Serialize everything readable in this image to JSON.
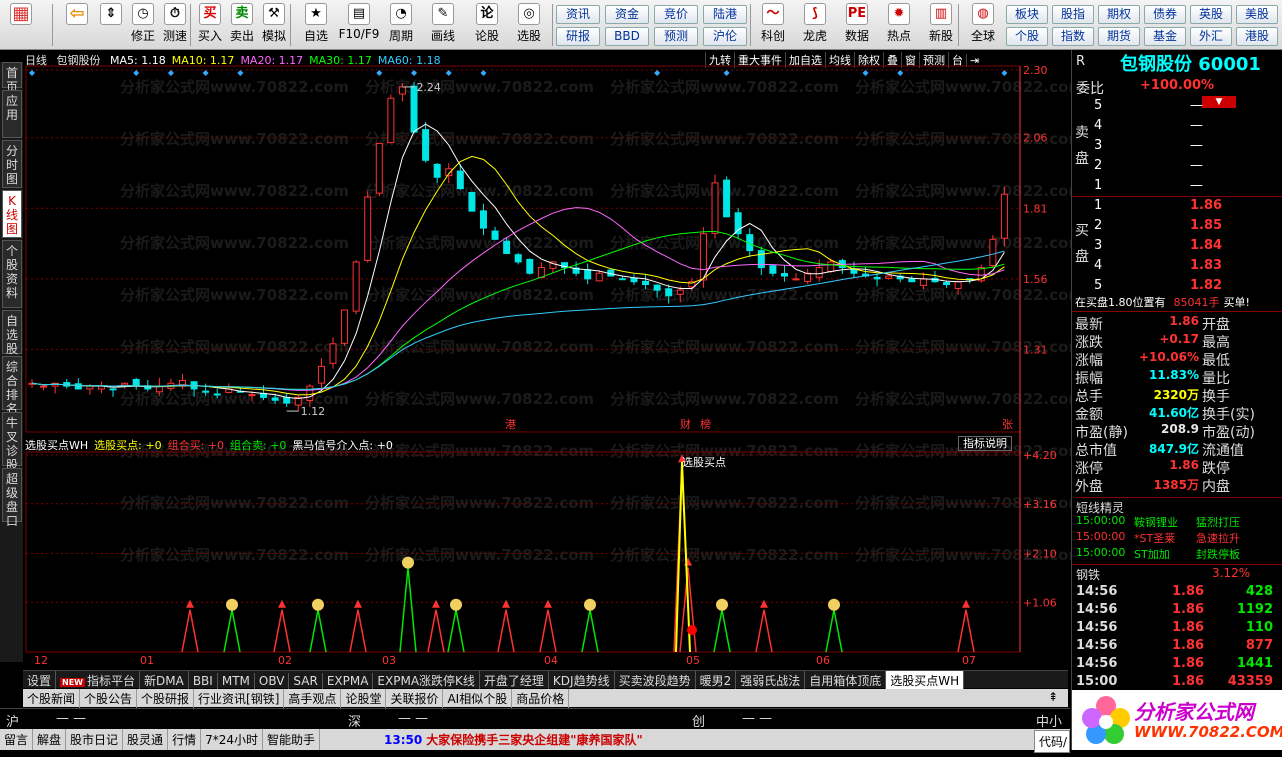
{
  "toolbar": {
    "buttons": [
      {
        "label": "",
        "icon": "grid-icon"
      },
      {
        "label": "",
        "icon": "back-arrow-icon"
      },
      {
        "label": "",
        "icon": "updown-icon"
      },
      {
        "label": "修正",
        "icon": "revise-icon"
      },
      {
        "label": "测速",
        "icon": "clock-icon"
      },
      {
        "label": "买入",
        "icon": "buy-icon"
      },
      {
        "label": "卖出",
        "icon": "sell-icon"
      },
      {
        "label": "模拟",
        "icon": "hammer-icon"
      },
      {
        "label": "自选",
        "icon": "star-icon"
      },
      {
        "label": "F10/F9",
        "icon": "f10-icon"
      },
      {
        "label": "周期",
        "icon": "period-icon"
      },
      {
        "label": "画线",
        "icon": "pen-icon"
      },
      {
        "label": "论股",
        "icon": "forum-icon"
      },
      {
        "label": "选股",
        "icon": "select-stock-icon"
      }
    ],
    "quick": [
      [
        "资讯",
        "资金",
        "竞价",
        "陆港"
      ],
      [
        "研报",
        "BBD",
        "预测",
        "沪伦"
      ]
    ],
    "big": [
      {
        "label": "科创",
        "icon": "kechuang-icon"
      },
      {
        "label": "龙虎",
        "icon": "dragon-icon"
      },
      {
        "label": "数据",
        "icon": "pe-icon"
      },
      {
        "label": "热点",
        "icon": "hot-icon"
      },
      {
        "label": "新股",
        "icon": "ipo-icon"
      },
      {
        "label": "全球",
        "icon": "globe-icon"
      }
    ],
    "right_quick": [
      [
        "板块",
        "股指",
        "期权",
        "债券",
        "英股",
        "美股"
      ],
      [
        "个股",
        "指数",
        "期货",
        "基金",
        "外汇",
        "港股"
      ]
    ]
  },
  "sidetabs": [
    "首页",
    "应用",
    "分时图",
    "K线图",
    "个股资料",
    "自选股",
    "综合排名",
    "牛叉诊股",
    "超级盘口"
  ],
  "chart_header": {
    "period": "日线",
    "stock": "包钢股份",
    "ma": [
      {
        "label": "MA5: 1.18",
        "color": "#ffffff"
      },
      {
        "label": "MA10: 1.17",
        "color": "#ffff00"
      },
      {
        "label": "MA20: 1.17",
        "color": "#ff66ff"
      },
      {
        "label": "MA30: 1.17",
        "color": "#00ff00"
      },
      {
        "label": "MA60: 1.18",
        "color": "#33ccff"
      }
    ]
  },
  "chart_tools": [
    "九转",
    "重大事件",
    "加自选",
    "均线",
    "除权",
    "叠",
    "窗",
    "预测",
    "台",
    "⇥"
  ],
  "chart_data": [
    {
      "type": "candlestick",
      "title": "包钢股份 日线",
      "y_axis_labels": [
        "2.30",
        "2.06",
        "1.81",
        "1.56",
        "1.31"
      ],
      "ylim": [
        1.06,
        2.3
      ],
      "x_labels": [
        "12",
        "01",
        "02",
        "03",
        "04",
        "05",
        "06",
        "07"
      ],
      "annotations": [
        {
          "text": "2.24",
          "kind": "high"
        },
        {
          "text": "1.12",
          "kind": "low"
        },
        {
          "text": "港",
          "kind": "event"
        },
        {
          "text": "财",
          "kind": "event"
        },
        {
          "text": "榜",
          "kind": "event"
        },
        {
          "text": "张",
          "kind": "event"
        }
      ],
      "series": [
        {
          "name": "MA5",
          "color": "#ffffff"
        },
        {
          "name": "MA10",
          "color": "#ffff00"
        },
        {
          "name": "MA20",
          "color": "#ff66ff"
        },
        {
          "name": "MA30",
          "color": "#00ff00"
        },
        {
          "name": "MA60",
          "color": "#33ccff"
        }
      ],
      "price_path": [
        1.19,
        1.18,
        1.19,
        1.18,
        1.17,
        1.18,
        1.18,
        1.17,
        1.19,
        1.18,
        1.17,
        1.18,
        1.19,
        1.2,
        1.17,
        1.16,
        1.15,
        1.17,
        1.16,
        1.15,
        1.14,
        1.13,
        1.12,
        1.14,
        1.18,
        1.25,
        1.33,
        1.45,
        1.62,
        1.85,
        2.04,
        2.2,
        2.24,
        2.08,
        1.98,
        1.92,
        1.95,
        1.88,
        1.8,
        1.74,
        1.7,
        1.65,
        1.62,
        1.58,
        1.6,
        1.62,
        1.6,
        1.58,
        1.56,
        1.58,
        1.57,
        1.56,
        1.55,
        1.54,
        1.52,
        1.5,
        1.52,
        1.55,
        1.72,
        1.9,
        1.78,
        1.72,
        1.66,
        1.6,
        1.58,
        1.57,
        1.56,
        1.58,
        1.6,
        1.62,
        1.6,
        1.58,
        1.57,
        1.56,
        1.57,
        1.56,
        1.55,
        1.56,
        1.55,
        1.54,
        1.55,
        1.56,
        1.6,
        1.7,
        1.86
      ]
    },
    {
      "type": "indicator",
      "title": "选股买点WH",
      "y_axis_labels": [
        "+4.20",
        "+3.16",
        "+2.10",
        "+1.06"
      ],
      "ylim": [
        0,
        4.2
      ],
      "annotations": [
        {
          "text": "选股买点",
          "kind": "signal"
        }
      ]
    }
  ],
  "indicator_header": {
    "items": [
      {
        "label": "选股买点WH",
        "color": "#ffffff"
      },
      {
        "label": "选股买点: +0",
        "color": "#ffff00"
      },
      {
        "label": "组合买: +0",
        "color": "#ff3232"
      },
      {
        "label": "组合卖: +0",
        "color": "#00e600"
      },
      {
        "label": "黑马信号介入点: +0",
        "color": "#ffffff"
      }
    ],
    "help_button": "指标说明"
  },
  "right_panel": {
    "r_label": "R",
    "stock_name": "包钢股份 60001",
    "weibi_label": "委比",
    "weibi_value": "+100.00%",
    "sell_label": "卖盘",
    "buy_label": "买盘",
    "sell_orders": [
      {
        "level": "5",
        "price": "—",
        "vol": ""
      },
      {
        "level": "4",
        "price": "—",
        "vol": ""
      },
      {
        "level": "3",
        "price": "—",
        "vol": ""
      },
      {
        "level": "2",
        "price": "—",
        "vol": ""
      },
      {
        "level": "1",
        "price": "—",
        "vol": ""
      }
    ],
    "buy_orders": [
      {
        "level": "1",
        "price": "1.86",
        "vol": ""
      },
      {
        "level": "2",
        "price": "1.85",
        "vol": ""
      },
      {
        "level": "3",
        "price": "1.84",
        "vol": ""
      },
      {
        "level": "4",
        "price": "1.83",
        "vol": ""
      },
      {
        "level": "5",
        "price": "1.82",
        "vol": ""
      }
    ],
    "position_line": {
      "pre": "在买盘1.80位置有",
      "value": "85041手",
      "post": "买单!"
    },
    "stats": [
      {
        "l1": "最新",
        "v1": "1.86",
        "c1": "red",
        "l2": "开盘",
        "v2": ""
      },
      {
        "l1": "涨跌",
        "v1": "+0.17",
        "c1": "red",
        "l2": "最高",
        "v2": ""
      },
      {
        "l1": "涨幅",
        "v1": "+10.06%",
        "c1": "red",
        "l2": "最低",
        "v2": ""
      },
      {
        "l1": "振幅",
        "v1": "11.83%",
        "c1": "cyan",
        "l2": "量比",
        "v2": ""
      },
      {
        "l1": "总手",
        "v1": "2320万",
        "c1": "yellow",
        "l2": "换手",
        "v2": ""
      },
      {
        "l1": "金额",
        "v1": "41.60亿",
        "c1": "cyan",
        "l2": "换手(实)",
        "v2": ""
      },
      {
        "l1": "市盈(静)",
        "v1": "208.9",
        "c1": "white",
        "l2": "市盈(动)",
        "v2": ""
      },
      {
        "l1": "总市值",
        "v1": "847.9亿",
        "c1": "cyan",
        "l2": "流通值",
        "v2": ""
      },
      {
        "l1": "涨停",
        "v1": "1.86",
        "c1": "red",
        "l2": "跌停",
        "v2": ""
      },
      {
        "l1": "外盘",
        "v1": "1385万",
        "c1": "red",
        "l2": "内盘",
        "v2": ""
      }
    ],
    "sprite_title": "短线精灵",
    "sprite_rows": [
      {
        "time": "15:00:00",
        "name": "鞍钢锂业",
        "event": "猛烈打压",
        "color": "green"
      },
      {
        "time": "15:00:00",
        "name": "*ST圣莱",
        "event": "急速拉升",
        "color": "red"
      },
      {
        "time": "15:00:00",
        "name": "ST加加",
        "event": "封跌停板",
        "color": "green"
      }
    ],
    "sector_name": "钢铁",
    "sector_change": "3.12%",
    "ticks": [
      {
        "time": "14:56",
        "price": "1.86",
        "vol": "428",
        "color": "green"
      },
      {
        "time": "14:56",
        "price": "1.86",
        "vol": "1192",
        "color": "green"
      },
      {
        "time": "14:56",
        "price": "1.86",
        "vol": "110",
        "color": "green"
      },
      {
        "time": "14:56",
        "price": "1.86",
        "vol": "877",
        "color": "red"
      },
      {
        "time": "14:56",
        "price": "1.86",
        "vol": "1441",
        "color": "green"
      },
      {
        "time": "15:00",
        "price": "1.86",
        "vol": "43359",
        "color": "red"
      }
    ]
  },
  "bottom_tabs": [
    "设置",
    "指标平台",
    "新DMA",
    "BBI",
    "MTM",
    "OBV",
    "SAR",
    "EXPMA",
    "EXPMA涨跌停K线",
    "开盘了经理",
    "KDJ趋势线",
    "买卖波段趋势",
    "暖男2",
    "强弱氏战法",
    "自用箱体顶底",
    "选股买点WH"
  ],
  "new_badge": "NEW",
  "news_tabs": [
    "个股新闻",
    "个股公告",
    "个股研报",
    "行业资讯[钢铁]",
    "高手观点",
    "论股堂",
    "关联报价",
    "AI相似个股",
    "商品价格"
  ],
  "index_bar": [
    {
      "name": "沪",
      "value": "—  —"
    },
    {
      "name": "深",
      "value": "—  —"
    },
    {
      "name": "创",
      "value": "—  —"
    },
    {
      "name": "中小",
      "value": ""
    }
  ],
  "status_bar": {
    "items": [
      "留言",
      "解盘",
      "股市日记",
      "股灵通",
      "行情",
      "7*24小时",
      "智能助手"
    ],
    "headline_time": "13:50",
    "headline": "大家保险携手三家央企组建\"康养国家队\"",
    "code_input": "代码/"
  },
  "watermark_text": "分析家公式网www.70822.com",
  "logo": {
    "title": "分析家公式网",
    "url": "WWW.70822.COM"
  },
  "colors": {
    "up": "#ff3232",
    "down": "#00e6e6",
    "grid": "#800000",
    "axis": "#ff3232"
  }
}
